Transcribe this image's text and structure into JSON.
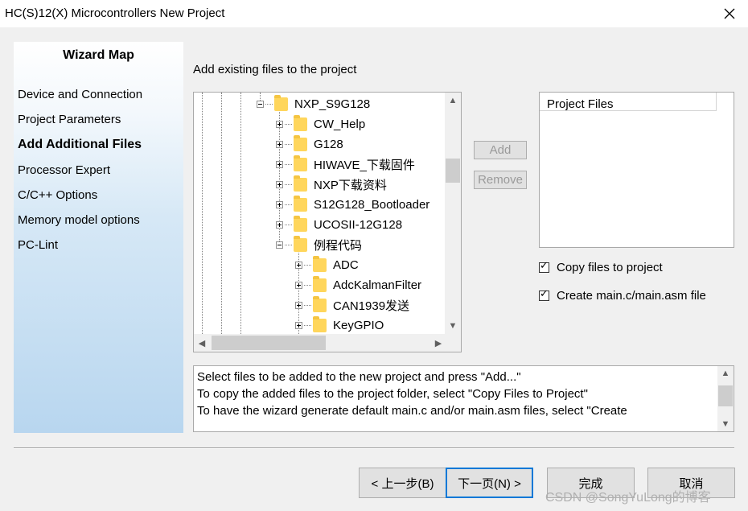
{
  "window": {
    "title": "HC(S)12(X) Microcontrollers New Project",
    "close_icon": "close-icon"
  },
  "sidebar": {
    "title": "Wizard Map",
    "items": [
      {
        "label": "Device and Connection",
        "active": false
      },
      {
        "label": "Project Parameters",
        "active": false
      },
      {
        "label": "Add Additional Files",
        "active": true
      },
      {
        "label": "Processor Expert",
        "active": false
      },
      {
        "label": "C/C++ Options",
        "active": false
      },
      {
        "label": "Memory model options",
        "active": false
      },
      {
        "label": "PC-Lint",
        "active": false
      }
    ]
  },
  "heading": "Add existing files to the project",
  "tree": {
    "items": [
      {
        "label": "NXP_S9G128",
        "depth": 0,
        "expanded": true
      },
      {
        "label": "CW_Help",
        "depth": 1,
        "expanded": false
      },
      {
        "label": "G128",
        "depth": 1,
        "expanded": false
      },
      {
        "label": "HIWAVE_下载固件",
        "depth": 1,
        "expanded": false
      },
      {
        "label": "NXP下载资料",
        "depth": 1,
        "expanded": false
      },
      {
        "label": "S12G128_Bootloader",
        "depth": 1,
        "expanded": false
      },
      {
        "label": "UCOSII-12G128",
        "depth": 1,
        "expanded": false
      },
      {
        "label": "例程代码",
        "depth": 1,
        "expanded": true
      },
      {
        "label": "ADC",
        "depth": 2,
        "expanded": false
      },
      {
        "label": "AdcKalmanFilter",
        "depth": 2,
        "expanded": false
      },
      {
        "label": "CAN1939发送",
        "depth": 2,
        "expanded": false
      },
      {
        "label": "KeyGPIO",
        "depth": 2,
        "expanded": false
      }
    ]
  },
  "buttons": {
    "add": "Add",
    "remove": "Remove"
  },
  "project_files": {
    "header": "Project Files"
  },
  "options": {
    "copy_files": {
      "label": "Copy files to project",
      "checked": true
    },
    "create_main": {
      "label": "Create main.c/main.asm file",
      "checked": true
    }
  },
  "info": {
    "lines": [
      "Select files to be added to the new project and press \"Add...\"",
      "To copy the added files to the project folder, select \"Copy Files to Project\"",
      "To have the wizard generate default main.c and/or main.asm files, select \"Create"
    ]
  },
  "footer": {
    "back": "< 上一步(B)",
    "next": "下一页(N) >",
    "finish": "完成",
    "cancel": "取消"
  },
  "watermark": "CSDN @SongYuLong的博客"
}
